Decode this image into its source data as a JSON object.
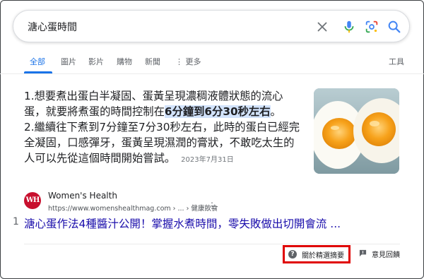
{
  "search": {
    "query": "溏心蛋時間"
  },
  "tabs": [
    {
      "label": "全部"
    },
    {
      "label": "圖片"
    },
    {
      "label": "影片"
    },
    {
      "label": "購物"
    },
    {
      "label": "新聞"
    },
    {
      "label": "更多"
    }
  ],
  "tools_label": "工具",
  "snippet": {
    "part1": "1.想要煮出蛋白半凝固、蛋黃呈現濃稠液體狀態的流心蛋，就要將煮蛋的時間控制在",
    "highlight": "6分鐘到6分30秒左右",
    "part2": "。",
    "part3": "2.繼續往下煮到7分鐘至7分30秒左右，此時的蛋白已經完全凝固，口感彈牙，蛋黃呈現濕潤的膏狀，不敢吃太生的人可以先從這個時間開始嘗試。",
    "date": "2023年7月31日"
  },
  "source": {
    "favicon_text": "WH",
    "name": "Women's Health",
    "url": "https://www.womenshealthmag.com › ... › 健康飲食",
    "more": "⋮"
  },
  "result": {
    "marker": "1",
    "title": "溏心蛋作法4種醬汁公開！掌握水煮時間，零失敗做出切開會流 ..."
  },
  "footer": {
    "about_icon": "?",
    "about_label": "關於精選摘要",
    "feedback_label": "意見回饋"
  },
  "colors": {
    "accent": "#1a73e8",
    "link": "#1a0dab",
    "highlight": "#d2e3fc",
    "annotation_box": "#e00000"
  }
}
